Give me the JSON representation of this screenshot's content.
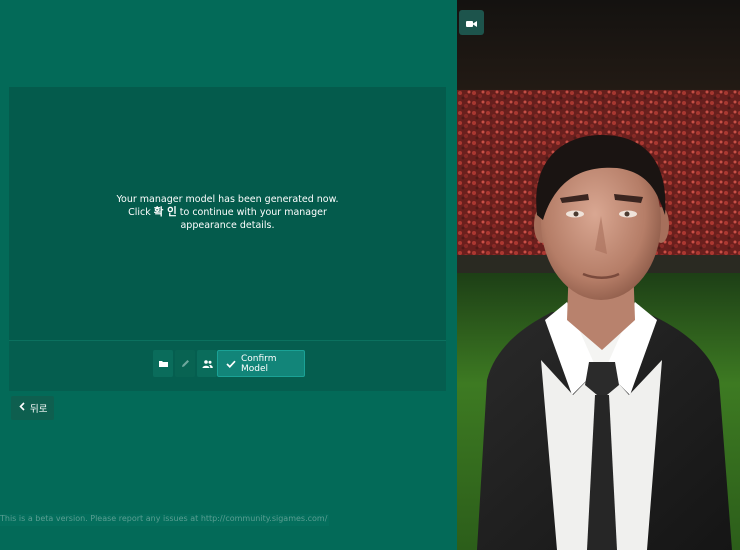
{
  "colors": {
    "background": "#036a58",
    "panel": "#045b4c",
    "confirm_button": "#128579",
    "accent_text": "#ffffff"
  },
  "panel": {
    "message_line1": "Your manager model has been generated now.",
    "message_line2_prefix": "Click",
    "message_line2_highlight": "확 인",
    "message_line2_suffix": "to continue with your manager",
    "message_line3": "appearance details."
  },
  "toolbar": {
    "folder_icon": "folder-icon",
    "edit_icon": "pencil-icon",
    "people_icon": "people-icon",
    "confirm_label": "Confirm Model",
    "confirm_icon": "checkmark-icon"
  },
  "back": {
    "label": "뒤로",
    "icon": "chevron-left-icon"
  },
  "footer": {
    "beta_notice": "This is a beta version. Please report any issues at http://community.sigames.com/"
  },
  "viewer": {
    "camera_icon": "video-camera-icon"
  }
}
